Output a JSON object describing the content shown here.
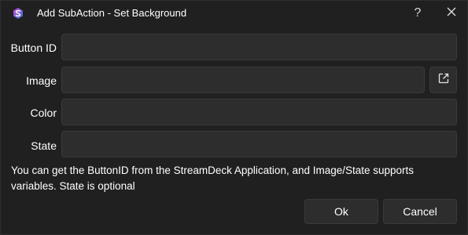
{
  "window": {
    "title": "Add SubAction - Set Background",
    "help_label": "?",
    "app_icon": "streamerbot-logo-icon",
    "close_icon": "close-icon"
  },
  "form": {
    "button_id": {
      "label": "Button ID",
      "value": ""
    },
    "image": {
      "label": "Image",
      "value": "",
      "browse_icon": "open-external-icon"
    },
    "color": {
      "label": "Color",
      "value": ""
    },
    "state": {
      "label": "State",
      "value": ""
    }
  },
  "note": "You can get the ButtonID from the StreamDeck Application, and Image/State supports variables. State is optional",
  "buttons": {
    "ok": "Ok",
    "cancel": "Cancel"
  },
  "colors": {
    "background": "#202020",
    "field_bg": "#2d2d2d",
    "field_border": "#3a3a3a",
    "logo_blue": "#3b6fd8",
    "logo_pink": "#c84fd6"
  }
}
